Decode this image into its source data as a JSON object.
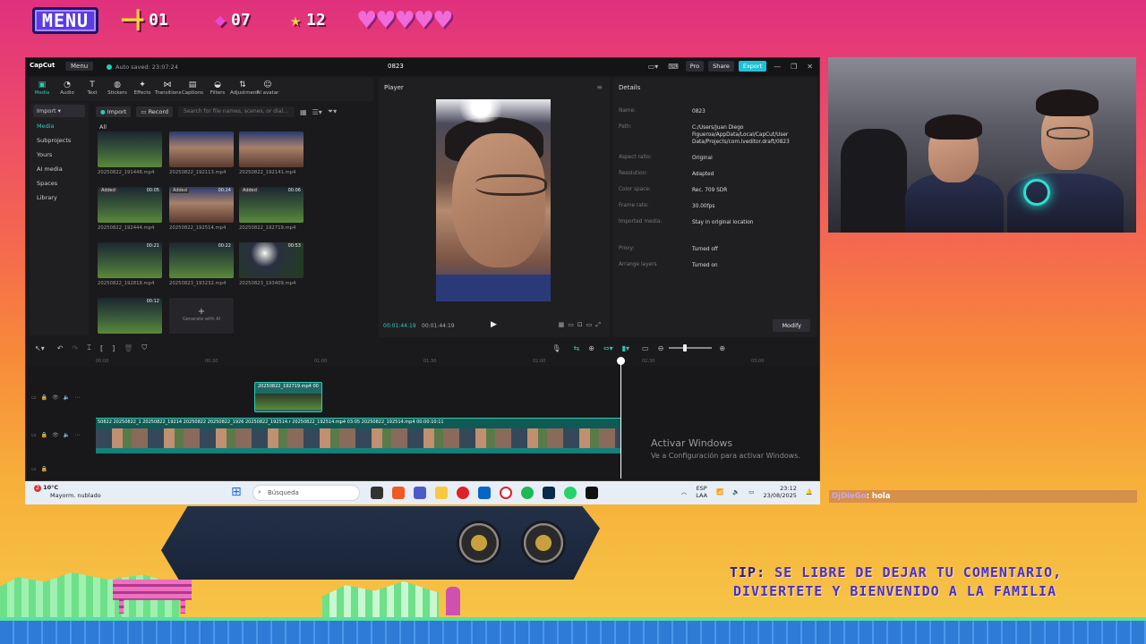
{
  "overlay": {
    "menu_label": "MENU",
    "swords": "01",
    "gems": "07",
    "stars": "12",
    "hearts": "♥♥♥♥♥",
    "tip_label": "TIP:",
    "tip_line1": "SE LIBRE DE DEJAR TU COMENTARIO,",
    "tip_line2": "DIVIERTETE Y BIENVENIDO A LA FAMILIA"
  },
  "capcut": {
    "logo": "CapCut",
    "menu": "Menu",
    "autosaved": "Auto saved: 23:07:24",
    "project_title": "0823",
    "pro": "Pro",
    "share": "Share",
    "export": "Export",
    "tools": [
      {
        "label": "Media",
        "glyph": "▣"
      },
      {
        "label": "Audio",
        "glyph": "◔"
      },
      {
        "label": "Text",
        "glyph": "T"
      },
      {
        "label": "Stickers",
        "glyph": "◍"
      },
      {
        "label": "Effects",
        "glyph": "✦"
      },
      {
        "label": "Transitions",
        "glyph": "⋈"
      },
      {
        "label": "Captions",
        "glyph": "▤"
      },
      {
        "label": "Filters",
        "glyph": "◒"
      },
      {
        "label": "Adjustment",
        "glyph": "⇅"
      },
      {
        "label": "AI avatar",
        "glyph": "☺"
      }
    ],
    "side": {
      "import": "Import",
      "media": "Media",
      "subprojects": "Subprojects",
      "yours": "Yours",
      "ai_media": "AI media",
      "spaces": "Spaces",
      "library": "Library"
    },
    "media_bar": {
      "import": "Import",
      "record": "Record",
      "search_placeholder": "Search for file names, scenes, or dial..."
    },
    "all_label": "All",
    "thumbs": [
      {
        "name": "20250822_191448.mp4",
        "badge": "",
        "dur": "",
        "kind": "field"
      },
      {
        "name": "20250822_192113.mp4",
        "badge": "",
        "dur": "",
        "kind": "face"
      },
      {
        "name": "20250822_192141.mp4",
        "badge": "",
        "dur": "",
        "kind": "face"
      },
      {
        "name": "20250822_192444.mp4",
        "badge": "Added",
        "dur": "00:05",
        "kind": "field"
      },
      {
        "name": "20250822_192514.mp4",
        "badge": "Added",
        "dur": "00:24",
        "kind": "face"
      },
      {
        "name": "20250822_192719.mp4",
        "badge": "Added",
        "dur": "00:06",
        "kind": "field"
      },
      {
        "name": "20250822_192818.mp4",
        "badge": "",
        "dur": "00:21",
        "kind": "field"
      },
      {
        "name": "20250823_193232.mp4",
        "badge": "",
        "dur": "00:22",
        "kind": "field"
      },
      {
        "name": "20250823_193409.mp4",
        "badge": "",
        "dur": "00:53",
        "kind": "night"
      },
      {
        "name": "",
        "badge": "",
        "dur": "00:12",
        "kind": "field"
      }
    ],
    "generate_ai": "Generate with AI",
    "player": {
      "title": "Player",
      "time_current": "00:01:44:19",
      "time_total": "00:01:44:19"
    },
    "details": {
      "title": "Details",
      "rows": [
        {
          "k": "Name:",
          "v": "0823"
        },
        {
          "k": "Path:",
          "v": "C:/Users/Juan Diego Figueroa/AppData/Local/CapCut/User Data/Projects/com.lveditor.draft/0823"
        },
        {
          "k": "Aspect ratio:",
          "v": "Original"
        },
        {
          "k": "Resolution:",
          "v": "Adapted"
        },
        {
          "k": "Color space:",
          "v": "Rec. 709 SDR"
        },
        {
          "k": "Frame rate:",
          "v": "30.00fps"
        },
        {
          "k": "Imported media:",
          "v": "Stay in original location"
        },
        {
          "k": "Proxy:",
          "v": "Turned off"
        },
        {
          "k": "Arrange layers",
          "v": "Turned on"
        }
      ],
      "modify": "Modify"
    },
    "timeline": {
      "small_clip": "20250822_192719.mp4  00",
      "main_clip_labels": "50822  20250822_1  20250822_19214  20250822  20250822_1926  20250822_192514.r  20250822_192514.mp4  03:05  20250822_192514.mp4  00:00:10:11",
      "ruler": [
        "00:00",
        "00:30",
        "01:00",
        "01:30",
        "02:00",
        "02:30",
        "03:00"
      ]
    },
    "activate_title": "Activar Windows",
    "activate_sub": "Ve a Configuración para activar Windows."
  },
  "taskbar": {
    "weather_badge": "2",
    "weather_temp": "10°C",
    "weather_desc": "Mayorm. nublado",
    "search": "Búsqueda",
    "lang1": "ESP",
    "lang2": "LAA",
    "time": "23:12",
    "date": "23/08/2025"
  },
  "chat": {
    "user": "DjDieGo",
    "message": ": hola"
  }
}
